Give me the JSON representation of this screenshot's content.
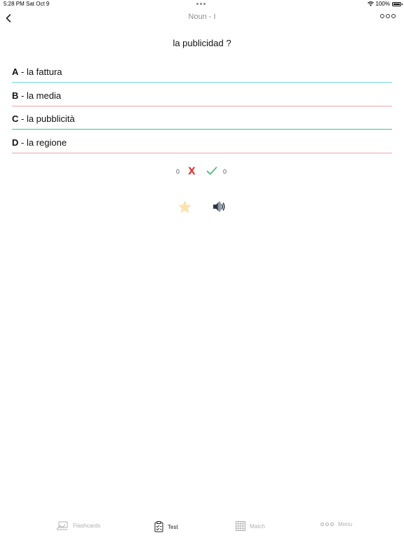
{
  "status": {
    "time": "5:28 PM",
    "date": "Sat Oct 9",
    "battery_pct": "100%",
    "battery_level": 1.0
  },
  "nav": {
    "title": "Noun - I",
    "back_icon": "chevron-left-icon",
    "more_icon": "more-dots-icon"
  },
  "question": "la publicidad ?",
  "answers": [
    {
      "letter": "A",
      "sep": " - ",
      "text": "la fattura",
      "color": "#6fd8df"
    },
    {
      "letter": "B",
      "sep": " - ",
      "text": "la media",
      "color": "#f0a3ab"
    },
    {
      "letter": "C",
      "sep": " - ",
      "text": "la pubblicità",
      "color": "#3fc49a"
    },
    {
      "letter": "D",
      "sep": " - ",
      "text": "la regione",
      "color": "#f0a3ab"
    }
  ],
  "score": {
    "wrong": "0",
    "right": "0",
    "wrong_icon": "x-mark-icon",
    "right_icon": "check-icon",
    "wrong_color": "#e23d3d",
    "right_color": "#3cb371"
  },
  "actions": {
    "star_icon": "star-icon",
    "speaker_icon": "speaker-icon"
  },
  "tabs": [
    {
      "label": "Flashcards",
      "icon": "flashcards-icon"
    },
    {
      "label": "Test",
      "icon": "test-clipboard-icon",
      "selected": true
    },
    {
      "label": "Match",
      "icon": "grid-icon"
    },
    {
      "label": "Menu",
      "icon": "menu-dots-icon"
    }
  ]
}
